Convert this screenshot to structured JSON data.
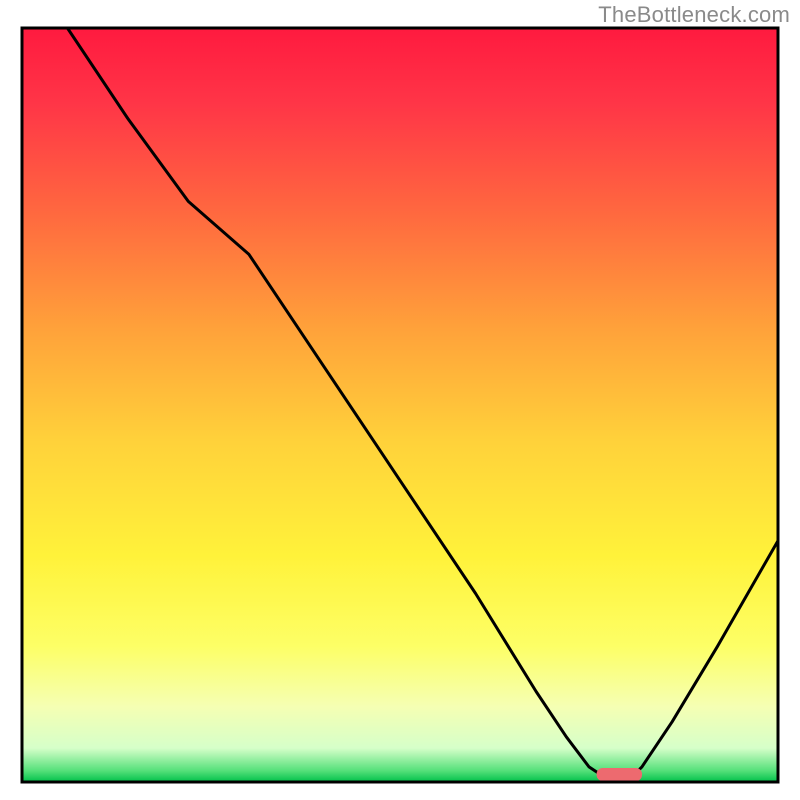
{
  "watermark": "TheBottleneck.com",
  "colors": {
    "curve": "#000000",
    "border": "#000000",
    "marker": "#ed6a6f",
    "gradient_stops": [
      {
        "offset": 0.0,
        "color": "#ff1a3f"
      },
      {
        "offset": 0.1,
        "color": "#ff3547"
      },
      {
        "offset": 0.25,
        "color": "#ff6a3f"
      },
      {
        "offset": 0.4,
        "color": "#ffa23a"
      },
      {
        "offset": 0.55,
        "color": "#ffd23a"
      },
      {
        "offset": 0.7,
        "color": "#fff23a"
      },
      {
        "offset": 0.82,
        "color": "#fdff66"
      },
      {
        "offset": 0.9,
        "color": "#f5ffb3"
      },
      {
        "offset": 0.955,
        "color": "#d6ffc9"
      },
      {
        "offset": 0.985,
        "color": "#55e07a"
      },
      {
        "offset": 1.0,
        "color": "#00c04a"
      }
    ]
  },
  "chart_data": {
    "type": "line",
    "title": "",
    "xlabel": "",
    "ylabel": "",
    "xlim": [
      0,
      100
    ],
    "ylim": [
      0,
      100
    ],
    "x": [
      0,
      6,
      14,
      22,
      30,
      40,
      50,
      60,
      68,
      72,
      75,
      78,
      80,
      82,
      86,
      92,
      100
    ],
    "values": [
      112,
      100,
      88,
      77,
      70,
      55,
      40,
      25,
      12,
      6,
      2,
      0,
      0,
      2,
      8,
      18,
      32
    ],
    "optimal_x_range": [
      76,
      82
    ],
    "description": "Bottleneck curve: y is distance from optimal (0 = ideal, higher = worse). Curve descends steeply from top-left, reaches zero near x≈76–82, then rises toward the right. Background is a vertical red→yellow→green gradient (green at bottom indicating optimal band)."
  }
}
